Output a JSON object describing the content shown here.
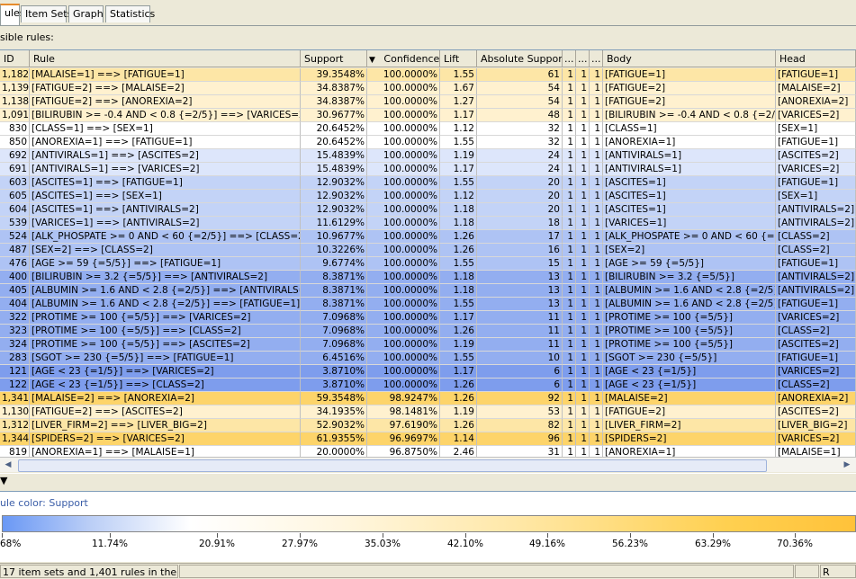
{
  "tabs": [
    "ules",
    "Item Sets",
    "Graph",
    "Statistics"
  ],
  "visible_label": "sible rules:",
  "columns": [
    "ID",
    "Rule",
    "Support",
    "Confidence",
    "Lift",
    "Absolute Support",
    "...",
    "...",
    "...",
    "Body",
    "Head"
  ],
  "sort_indicator": "▼",
  "colors": {
    "orange_strong": "#fdd46a",
    "orange_mid": "#fde6a6",
    "orange_light": "#fff1cf",
    "white": "#ffffff",
    "blue_light": "#dde6fb",
    "blue_mid": "#c3d3f7",
    "blue_mid2": "#aec3f4",
    "blue_strong": "#93aef0",
    "blue_deep": "#7e9ded"
  },
  "rows": [
    {
      "id": "1,182",
      "rule": "[MALAISE=1] ==> [FATIGUE=1]",
      "support": "39.3548%",
      "confidence": "100.0000%",
      "lift": "1.55",
      "abs": "61",
      "a": "1",
      "b": "1",
      "c": "1",
      "body": "[FATIGUE=1]",
      "head": "[FATIGUE=1]",
      "color": "orange_mid"
    },
    {
      "id": "1,139",
      "rule": "[FATIGUE=2] ==> [MALAISE=2]",
      "support": "34.8387%",
      "confidence": "100.0000%",
      "lift": "1.67",
      "abs": "54",
      "a": "1",
      "b": "1",
      "c": "1",
      "body": "[FATIGUE=2]",
      "head": "[MALAISE=2]",
      "color": "orange_light"
    },
    {
      "id": "1,138",
      "rule": "[FATIGUE=2] ==> [ANOREXIA=2]",
      "support": "34.8387%",
      "confidence": "100.0000%",
      "lift": "1.27",
      "abs": "54",
      "a": "1",
      "b": "1",
      "c": "1",
      "body": "[FATIGUE=2]",
      "head": "[ANOREXIA=2]",
      "color": "orange_light"
    },
    {
      "id": "1,091",
      "rule": "[BILIRUBIN >= -0.4 AND < 0.8  {=2/5}] ==> [VARICES=2]",
      "support": "30.9677%",
      "confidence": "100.0000%",
      "lift": "1.17",
      "abs": "48",
      "a": "1",
      "b": "1",
      "c": "1",
      "body": "[BILIRUBIN >= -0.4 AND < 0.8  {=2/5}]",
      "head": "[VARICES=2]",
      "color": "orange_light"
    },
    {
      "id": "830",
      "rule": "[CLASS=1] ==> [SEX=1]",
      "support": "20.6452%",
      "confidence": "100.0000%",
      "lift": "1.12",
      "abs": "32",
      "a": "1",
      "b": "1",
      "c": "1",
      "body": "[CLASS=1]",
      "head": "[SEX=1]",
      "color": "white"
    },
    {
      "id": "850",
      "rule": "[ANOREXIA=1] ==> [FATIGUE=1]",
      "support": "20.6452%",
      "confidence": "100.0000%",
      "lift": "1.55",
      "abs": "32",
      "a": "1",
      "b": "1",
      "c": "1",
      "body": "[ANOREXIA=1]",
      "head": "[FATIGUE=1]",
      "color": "white"
    },
    {
      "id": "692",
      "rule": "[ANTIVIRALS=1] ==> [ASCITES=2]",
      "support": "15.4839%",
      "confidence": "100.0000%",
      "lift": "1.19",
      "abs": "24",
      "a": "1",
      "b": "1",
      "c": "1",
      "body": "[ANTIVIRALS=1]",
      "head": "[ASCITES=2]",
      "color": "blue_light"
    },
    {
      "id": "691",
      "rule": "[ANTIVIRALS=1] ==> [VARICES=2]",
      "support": "15.4839%",
      "confidence": "100.0000%",
      "lift": "1.17",
      "abs": "24",
      "a": "1",
      "b": "1",
      "c": "1",
      "body": "[ANTIVIRALS=1]",
      "head": "[VARICES=2]",
      "color": "blue_light"
    },
    {
      "id": "603",
      "rule": "[ASCITES=1] ==> [FATIGUE=1]",
      "support": "12.9032%",
      "confidence": "100.0000%",
      "lift": "1.55",
      "abs": "20",
      "a": "1",
      "b": "1",
      "c": "1",
      "body": "[ASCITES=1]",
      "head": "[FATIGUE=1]",
      "color": "blue_mid"
    },
    {
      "id": "605",
      "rule": "[ASCITES=1] ==> [SEX=1]",
      "support": "12.9032%",
      "confidence": "100.0000%",
      "lift": "1.12",
      "abs": "20",
      "a": "1",
      "b": "1",
      "c": "1",
      "body": "[ASCITES=1]",
      "head": "[SEX=1]",
      "color": "blue_mid"
    },
    {
      "id": "604",
      "rule": "[ASCITES=1] ==> [ANTIVIRALS=2]",
      "support": "12.9032%",
      "confidence": "100.0000%",
      "lift": "1.18",
      "abs": "20",
      "a": "1",
      "b": "1",
      "c": "1",
      "body": "[ASCITES=1]",
      "head": "[ANTIVIRALS=2]",
      "color": "blue_mid"
    },
    {
      "id": "539",
      "rule": "[VARICES=1] ==> [ANTIVIRALS=2]",
      "support": "11.6129%",
      "confidence": "100.0000%",
      "lift": "1.18",
      "abs": "18",
      "a": "1",
      "b": "1",
      "c": "1",
      "body": "[VARICES=1]",
      "head": "[ANTIVIRALS=2]",
      "color": "blue_mid"
    },
    {
      "id": "524",
      "rule": "[ALK_PHOSPATE >= 0 AND < 60  {=2/5}] ==> [CLASS=2]",
      "support": "10.9677%",
      "confidence": "100.0000%",
      "lift": "1.26",
      "abs": "17",
      "a": "1",
      "b": "1",
      "c": "1",
      "body": "[ALK_PHOSPATE >= 0 AND < 60  {=...",
      "head": "[CLASS=2]",
      "color": "blue_mid2"
    },
    {
      "id": "487",
      "rule": "[SEX=2] ==> [CLASS=2]",
      "support": "10.3226%",
      "confidence": "100.0000%",
      "lift": "1.26",
      "abs": "16",
      "a": "1",
      "b": "1",
      "c": "1",
      "body": "[SEX=2]",
      "head": "[CLASS=2]",
      "color": "blue_mid2"
    },
    {
      "id": "476",
      "rule": "[AGE >= 59  {=5/5}] ==> [FATIGUE=1]",
      "support": "9.6774%",
      "confidence": "100.0000%",
      "lift": "1.55",
      "abs": "15",
      "a": "1",
      "b": "1",
      "c": "1",
      "body": "[AGE >= 59  {=5/5}]",
      "head": "[FATIGUE=1]",
      "color": "blue_mid2"
    },
    {
      "id": "400",
      "rule": "[BILIRUBIN >= 3.2  {=5/5}] ==> [ANTIVIRALS=2]",
      "support": "8.3871%",
      "confidence": "100.0000%",
      "lift": "1.18",
      "abs": "13",
      "a": "1",
      "b": "1",
      "c": "1",
      "body": "[BILIRUBIN >= 3.2  {=5/5}]",
      "head": "[ANTIVIRALS=2]",
      "color": "blue_strong"
    },
    {
      "id": "405",
      "rule": "[ALBUMIN >= 1.6 AND < 2.8  {=2/5}] ==> [ANTIVIRALS=2]",
      "support": "8.3871%",
      "confidence": "100.0000%",
      "lift": "1.18",
      "abs": "13",
      "a": "1",
      "b": "1",
      "c": "1",
      "body": "[ALBUMIN >= 1.6 AND < 2.8  {=2/5}]",
      "head": "[ANTIVIRALS=2]",
      "color": "blue_strong"
    },
    {
      "id": "404",
      "rule": "[ALBUMIN >= 1.6 AND < 2.8  {=2/5}] ==> [FATIGUE=1]",
      "support": "8.3871%",
      "confidence": "100.0000%",
      "lift": "1.55",
      "abs": "13",
      "a": "1",
      "b": "1",
      "c": "1",
      "body": "[ALBUMIN >= 1.6 AND < 2.8  {=2/5}]",
      "head": "[FATIGUE=1]",
      "color": "blue_strong"
    },
    {
      "id": "322",
      "rule": "[PROTIME >= 100  {=5/5}] ==> [VARICES=2]",
      "support": "7.0968%",
      "confidence": "100.0000%",
      "lift": "1.17",
      "abs": "11",
      "a": "1",
      "b": "1",
      "c": "1",
      "body": "[PROTIME >= 100  {=5/5}]",
      "head": "[VARICES=2]",
      "color": "blue_strong"
    },
    {
      "id": "323",
      "rule": "[PROTIME >= 100  {=5/5}] ==> [CLASS=2]",
      "support": "7.0968%",
      "confidence": "100.0000%",
      "lift": "1.26",
      "abs": "11",
      "a": "1",
      "b": "1",
      "c": "1",
      "body": "[PROTIME >= 100  {=5/5}]",
      "head": "[CLASS=2]",
      "color": "blue_strong"
    },
    {
      "id": "324",
      "rule": "[PROTIME >= 100  {=5/5}] ==> [ASCITES=2]",
      "support": "7.0968%",
      "confidence": "100.0000%",
      "lift": "1.19",
      "abs": "11",
      "a": "1",
      "b": "1",
      "c": "1",
      "body": "[PROTIME >= 100  {=5/5}]",
      "head": "[ASCITES=2]",
      "color": "blue_strong"
    },
    {
      "id": "283",
      "rule": "[SGOT >= 230  {=5/5}] ==> [FATIGUE=1]",
      "support": "6.4516%",
      "confidence": "100.0000%",
      "lift": "1.55",
      "abs": "10",
      "a": "1",
      "b": "1",
      "c": "1",
      "body": "[SGOT >= 230  {=5/5}]",
      "head": "[FATIGUE=1]",
      "color": "blue_strong"
    },
    {
      "id": "121",
      "rule": "[AGE < 23  {=1/5}] ==> [VARICES=2]",
      "support": "3.8710%",
      "confidence": "100.0000%",
      "lift": "1.17",
      "abs": "6",
      "a": "1",
      "b": "1",
      "c": "1",
      "body": "[AGE < 23  {=1/5}]",
      "head": "[VARICES=2]",
      "color": "blue_deep"
    },
    {
      "id": "122",
      "rule": "[AGE < 23  {=1/5}] ==> [CLASS=2]",
      "support": "3.8710%",
      "confidence": "100.0000%",
      "lift": "1.26",
      "abs": "6",
      "a": "1",
      "b": "1",
      "c": "1",
      "body": "[AGE < 23  {=1/5}]",
      "head": "[CLASS=2]",
      "color": "blue_deep"
    },
    {
      "id": "1,341",
      "rule": "[MALAISE=2] ==> [ANOREXIA=2]",
      "support": "59.3548%",
      "confidence": "98.9247%",
      "lift": "1.26",
      "abs": "92",
      "a": "1",
      "b": "1",
      "c": "1",
      "body": "[MALAISE=2]",
      "head": "[ANOREXIA=2]",
      "color": "orange_strong"
    },
    {
      "id": "1,130",
      "rule": "[FATIGUE=2] ==> [ASCITES=2]",
      "support": "34.1935%",
      "confidence": "98.1481%",
      "lift": "1.19",
      "abs": "53",
      "a": "1",
      "b": "1",
      "c": "1",
      "body": "[FATIGUE=2]",
      "head": "[ASCITES=2]",
      "color": "orange_light"
    },
    {
      "id": "1,312",
      "rule": "[LIVER_FIRM=2] ==> [LIVER_BIG=2]",
      "support": "52.9032%",
      "confidence": "97.6190%",
      "lift": "1.26",
      "abs": "82",
      "a": "1",
      "b": "1",
      "c": "1",
      "body": "[LIVER_FIRM=2]",
      "head": "[LIVER_BIG=2]",
      "color": "orange_mid"
    },
    {
      "id": "1,344",
      "rule": "[SPIDERS=2] ==> [VARICES=2]",
      "support": "61.9355%",
      "confidence": "96.9697%",
      "lift": "1.14",
      "abs": "96",
      "a": "1",
      "b": "1",
      "c": "1",
      "body": "[SPIDERS=2]",
      "head": "[VARICES=2]",
      "color": "orange_strong"
    },
    {
      "id": "819",
      "rule": "[ANOREXIA=1] ==> [MALAISE=1]",
      "support": "20.0000%",
      "confidence": "96.8750%",
      "lift": "2.46",
      "abs": "31",
      "a": "1",
      "b": "1",
      "c": "1",
      "body": "[ANOREXIA=1]",
      "head": "[MALAISE=1]",
      "color": "white"
    }
  ],
  "legend": {
    "title": "ule color: Support",
    "ticks": [
      "68%",
      "11.74%",
      "20.91%",
      "27.97%",
      "35.03%",
      "42.10%",
      "49.16%",
      "56.23%",
      "63.29%",
      "70.36%"
    ]
  },
  "status": {
    "text": "17 item sets and 1,401 rules in the model",
    "right": "R"
  }
}
